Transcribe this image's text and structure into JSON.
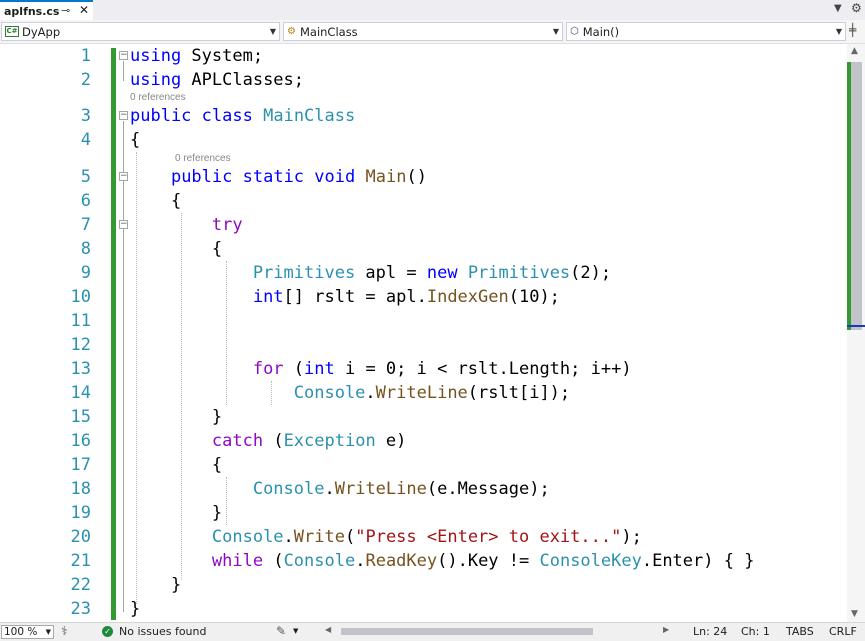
{
  "tab": {
    "filename": "aplfns.cs",
    "pin_glyph": "⊸",
    "close_glyph": "✕"
  },
  "navbar": {
    "project": "DyApp",
    "project_icon_label": "C#",
    "class": "MainClass",
    "member": "Main()"
  },
  "codelens": {
    "line3": "0 references",
    "line5": "0 references"
  },
  "code": {
    "line_numbers": [
      "1",
      "2",
      "3",
      "4",
      "5",
      "6",
      "7",
      "8",
      "9",
      "10",
      "11",
      "12",
      "13",
      "14",
      "15",
      "16",
      "17",
      "18",
      "19",
      "20",
      "21",
      "22",
      "23"
    ]
  },
  "statusbar": {
    "zoom": "100 %",
    "issues": "No issues found",
    "line": "Ln: 24",
    "column": "Ch: 1",
    "indent": "TABS",
    "line_ending": "CRLF"
  },
  "icons": {
    "tab_pin": "pin-icon",
    "tab_close": "close-icon",
    "overflow": "chevron-down-icon",
    "settings": "gear-icon",
    "split": "split-editor-icon",
    "health": "health-icon",
    "issues": "check-circle-icon",
    "cleanup": "brush-icon"
  },
  "colors": {
    "keyword": "#0000ff",
    "control_keyword": "#8f08c4",
    "type": "#2b91af",
    "method": "#74531f",
    "string": "#a31515",
    "line_number": "#2b91af",
    "change_bar": "#339933"
  }
}
